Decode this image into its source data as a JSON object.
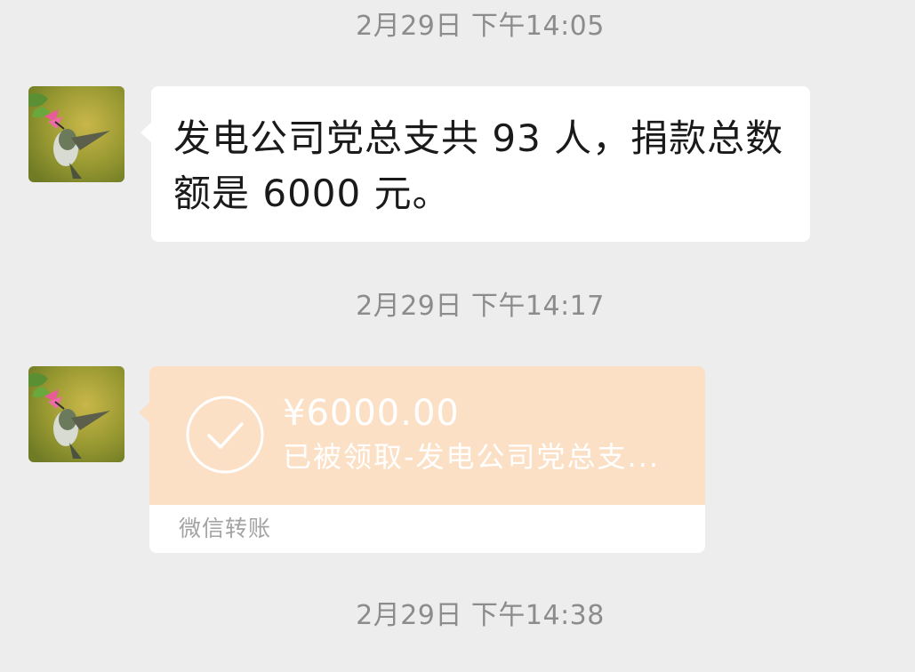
{
  "messages": [
    {
      "timestamp": "2月29日 下午14:05",
      "text_line1": "发电公司党总支共 93 人，捐款总数",
      "text_line2": "额是 6000 元。"
    },
    {
      "timestamp": "2月29日 下午14:17",
      "transfer": {
        "amount": "¥6000.00",
        "status": "已被领取-发电公司党总支...",
        "label": "微信转账"
      }
    },
    {
      "timestamp": "2月29日 下午14:38"
    }
  ],
  "colors": {
    "background": "#ededed",
    "bubble": "#ffffff",
    "transfer_accent": "#fce0c6",
    "timestamp_text": "#8c8c8c"
  },
  "icons": [
    "avatar-hummingbird",
    "check-circle-icon"
  ]
}
